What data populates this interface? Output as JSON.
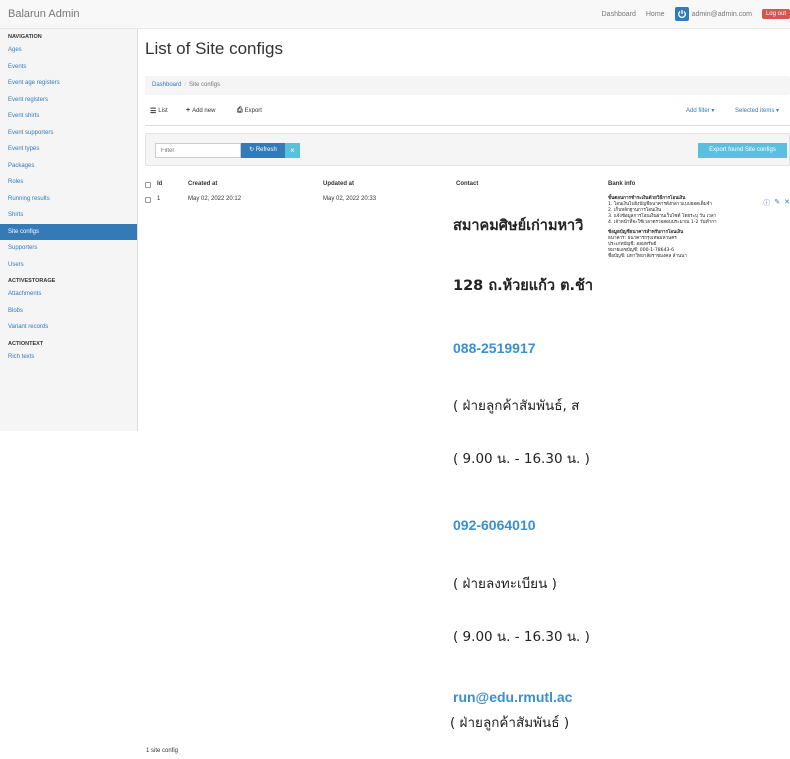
{
  "app": {
    "brand": "Balarun Admin"
  },
  "topnav": {
    "dashboard": "Dashboard",
    "home": "Home",
    "user": "admin@admin.com",
    "logout": "Log out"
  },
  "sidebar": {
    "navigation_header": "NAVIGATION",
    "nav_items": [
      "Ages",
      "Events",
      "Event age registers",
      "Event registers",
      "Event shirts",
      "Event supporters",
      "Event types",
      "Packages",
      "Roles",
      "Running results",
      "Shirts",
      "Site configs",
      "Supporters",
      "Users"
    ],
    "active_item": "Site configs",
    "activestorage_header": "ACTIVESTORAGE",
    "activestorage_items": [
      "Attachments",
      "Blobs",
      "Variant records"
    ],
    "actiontext_header": "ACTIONTEXT",
    "actiontext_items": [
      "Rich texts"
    ]
  },
  "page": {
    "title": "List of Site configs",
    "breadcrumb": {
      "dashboard": "Dashboard",
      "separator": "/",
      "current": "Site configs"
    },
    "tabs": {
      "list": "List",
      "add_new": "Add new",
      "export": "Export"
    },
    "add_filter": "Add filter ▾",
    "selected_items": "Selected items ▾",
    "filter": {
      "placeholder": "Filter",
      "refresh": "Refresh",
      "clear": "×"
    },
    "export_found": "Export found Site configs",
    "footer_count": "1 site config"
  },
  "table": {
    "headers": {
      "id": "Id",
      "created_at": "Created at",
      "updated_at": "Updated at",
      "contact": "Contact",
      "bank_info": "Bank info"
    },
    "rows": [
      {
        "id": "1",
        "created_at": "May 02, 2022 20:12",
        "updated_at": "May 02, 2022 20:33",
        "contact": {
          "line1": "สมาคมศิษย์เก่ามหาวิ",
          "line2": "128 ถ.ห้วยแก้ว ต.ช้า",
          "phone1": "088-2519917",
          "dept1": "( ฝ่ายลูกค้าสัมพันธ์, ส",
          "hours1": "( 9.00 น. - 16.30 น. )",
          "phone2": "092-6064010",
          "dept2": "( ฝ่ายลงทะเบียน )",
          "hours2": "( 9.00 น. - 16.30 น. )",
          "email": "run@edu.rmutl.ac",
          "dept3": "( ฝ่ายลูกค้าสัมพันธ์ )"
        },
        "bank": {
          "steps_title": "ขั้นตอนการชำระเงินด้วยวิธีการโอนเงิน",
          "steps": [
            "1.  โอนเงินไปยังบัญชีธนาคารดังกล่าวแบบยอดเต็มจำ",
            "2.  เก็บหลักฐานการโอนเงิน",
            "3.  แจ้งข้อมูลการโอนเงินผ่านเว็บไซต์ โดยระบุ วัน เวลา",
            "4.  เจ้าหน้าที่จะใช้เวลาตรวจสอบประมาณ 1-2 วันทำกา"
          ],
          "account_title": "ข้อมูลบัญชีธนาคารสำหรับการโอนเงิน",
          "bank_name": "ธนาคาร: ธนาคารกรุงเทพมหานคร",
          "account_type": "ประเภทบัญชี: ออมทรัพย์",
          "account_no": "หมายเลขบัญชี: 000-1-78643-6",
          "account_name": "ชื่อบัญชี: มหาวิทยาลัยราชมงคล ล้านนา"
        }
      }
    ]
  },
  "colors": {
    "link": "#337ab7",
    "active": "#337ab7",
    "info": "#5bc0de",
    "danger": "#d9534f"
  }
}
